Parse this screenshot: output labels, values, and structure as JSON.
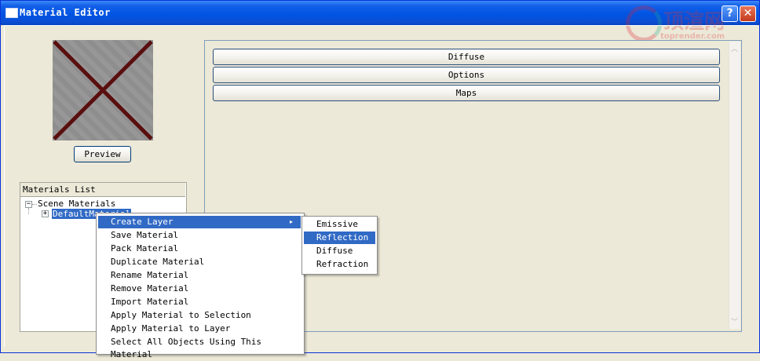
{
  "window": {
    "title": "Material Editor",
    "help_label": "?",
    "close_label": "✕"
  },
  "watermark": {
    "main_text": "顶渲网",
    "sub_text": "toprender.com"
  },
  "preview": {
    "button_label": "Preview"
  },
  "materials_list": {
    "header": "Materials List",
    "root_label": "Scene Materials",
    "root_toggle": "−",
    "child_label": "DefaultMaterial",
    "child_toggle": "+"
  },
  "rollouts": [
    {
      "label": "Diffuse"
    },
    {
      "label": "Options"
    },
    {
      "label": "Maps"
    }
  ],
  "context_menu": {
    "items": [
      {
        "label": "Create Layer",
        "has_submenu": true,
        "active": true
      },
      {
        "label": "Save Material"
      },
      {
        "label": "Pack Material"
      },
      {
        "label": "Duplicate Material"
      },
      {
        "label": "Rename Material"
      },
      {
        "label": "Remove Material"
      },
      {
        "label": "Import Material"
      },
      {
        "label": "Apply Material to Selection"
      },
      {
        "label": "Apply Material to Layer"
      },
      {
        "label": "Select All Objects Using This Material"
      }
    ],
    "submenu_arrow": "▸"
  },
  "submenu": {
    "items": [
      {
        "label": "Emissive"
      },
      {
        "label": "Reflection",
        "active": true
      },
      {
        "label": "Diffuse"
      },
      {
        "label": "Refraction"
      }
    ]
  },
  "scrollbar": {
    "up_arrow": "︿",
    "down_arrow": "﹀"
  },
  "colors": {
    "titlebar": "#0054e3",
    "selection": "#316ac5",
    "window_bg": "#ece9d8",
    "preview_cross": "#5a0e0e"
  }
}
